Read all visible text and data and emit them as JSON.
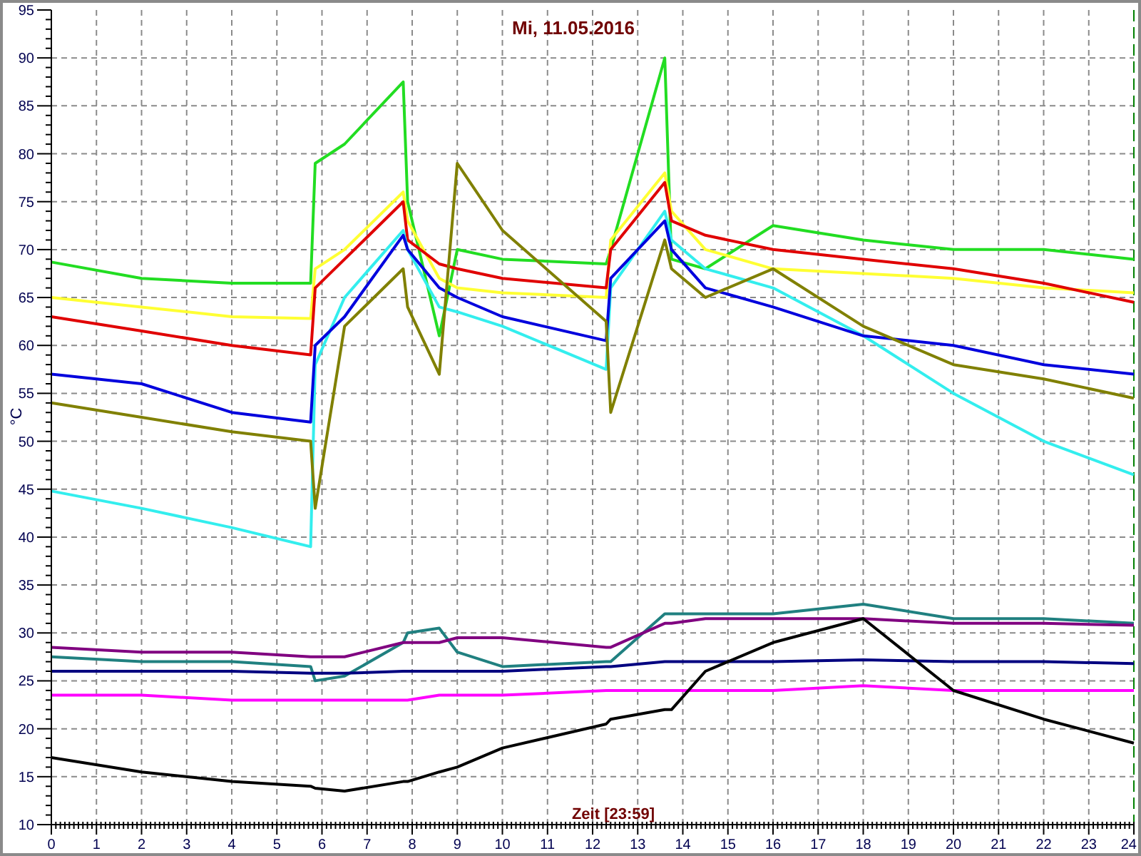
{
  "chart_data": {
    "type": "line",
    "title": "Mi, 11.05.2016",
    "xlabel": "Zeit [23:59]",
    "ylabel": "°C",
    "xlim": [
      0,
      24
    ],
    "ylim": [
      10,
      95
    ],
    "grid": true,
    "xticks": [
      0,
      1,
      2,
      3,
      4,
      5,
      6,
      7,
      8,
      9,
      10,
      11,
      12,
      13,
      14,
      15,
      16,
      17,
      18,
      19,
      20,
      21,
      22,
      23,
      24
    ],
    "yticks": [
      10,
      15,
      20,
      25,
      30,
      35,
      40,
      45,
      50,
      55,
      60,
      65,
      70,
      75,
      80,
      85,
      90,
      95
    ],
    "x": [
      0,
      2,
      4,
      5.75,
      5.85,
      6.5,
      7.8,
      7.9,
      8.6,
      9,
      10,
      12.3,
      12.4,
      13.6,
      13.75,
      14.5,
      16,
      18,
      20,
      22,
      24
    ],
    "series": [
      {
        "color": "#22dd22",
        "values": [
          68.7,
          67,
          66.5,
          66.5,
          79,
          81,
          87.5,
          75,
          61,
          70,
          69,
          68.5,
          70,
          90,
          69,
          68,
          72.5,
          71,
          70,
          70,
          69
        ]
      },
      {
        "color": "#ffff33",
        "values": [
          65,
          64,
          63,
          62.8,
          68,
          70,
          76,
          73,
          67,
          66,
          65.5,
          65,
          71,
          78,
          74,
          70,
          68,
          67.5,
          67,
          66,
          65.5
        ]
      },
      {
        "color": "#e00000",
        "values": [
          63,
          61.5,
          60,
          59,
          66,
          69,
          75,
          71,
          68.5,
          68,
          67,
          66,
          70,
          77,
          73,
          71.5,
          70,
          69,
          68,
          66.5,
          64.5
        ]
      },
      {
        "color": "#33eeee",
        "values": [
          44.8,
          43,
          41,
          39,
          58,
          65,
          72,
          70,
          64,
          63.5,
          62,
          57.5,
          66,
          74,
          71,
          68,
          66,
          61,
          55,
          50,
          46.5
        ]
      },
      {
        "color": "#0000dd",
        "values": [
          57,
          56,
          53,
          52,
          60,
          63,
          71.5,
          70,
          66,
          65,
          63,
          60.5,
          67,
          73,
          70,
          66,
          64,
          61,
          60,
          58,
          57
        ]
      },
      {
        "color": "#808000",
        "values": [
          54,
          52.5,
          51,
          50,
          43,
          62,
          68,
          64,
          57,
          79,
          72,
          62.5,
          53,
          71,
          68,
          65,
          68,
          62,
          58,
          56.5,
          54.5
        ]
      },
      {
        "color": "#208080",
        "values": [
          27.5,
          27,
          27,
          26.5,
          25,
          25.5,
          29,
          30,
          30.5,
          28,
          26.5,
          27,
          27,
          32,
          32,
          32,
          32,
          33,
          31.5,
          31.5,
          31
        ]
      },
      {
        "color": "#800080",
        "values": [
          28.5,
          28,
          28,
          27.5,
          27.5,
          27.5,
          29,
          29,
          29,
          29.5,
          29.5,
          28.5,
          28.5,
          31,
          31,
          31.5,
          31.5,
          31.5,
          31,
          31,
          30.8
        ]
      },
      {
        "color": "#000080",
        "values": [
          26,
          26,
          26,
          25.8,
          25.8,
          25.8,
          26,
          26,
          26,
          26,
          26,
          26.5,
          26.5,
          27,
          27,
          27,
          27,
          27.2,
          27,
          27,
          26.8
        ]
      },
      {
        "color": "#ff00ff",
        "values": [
          23.5,
          23.5,
          23,
          23,
          23,
          23,
          23,
          23,
          23.5,
          23.5,
          23.5,
          24,
          24,
          24,
          24,
          24,
          24,
          24.5,
          24,
          24,
          24
        ]
      },
      {
        "color": "#000000",
        "values": [
          17,
          15.5,
          14.5,
          14,
          13.8,
          13.5,
          14.5,
          14.5,
          15.5,
          16,
          18,
          20.5,
          21,
          22,
          22,
          26,
          29,
          31.5,
          24,
          21,
          18.5
        ]
      }
    ]
  }
}
